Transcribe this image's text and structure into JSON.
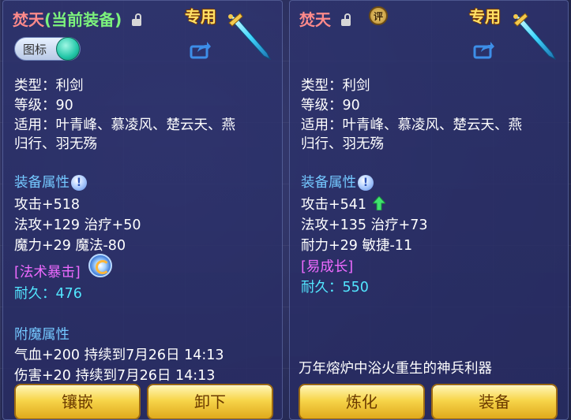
{
  "left": {
    "name": "焚天",
    "equipped_tag": "(当前装备)",
    "exclusive": "专用",
    "toggle_label": "图标",
    "type_line": "类型：利剑",
    "level_line": "等级：90",
    "applicable_line1": "适用：叶青峰、慕凌风、楚云天、燕",
    "applicable_line2": "归行、羽无殇",
    "attributes_title": "装备属性",
    "attack": "攻击+518",
    "magic_heal": "法攻+129 治疗+50",
    "demon_magic": "魔力+29 魔法-80",
    "special": "[法术暴击]",
    "durability_label": "耐久：",
    "durability_value": "476",
    "enchant_title": "附魔属性",
    "enchant1": "气血+200 持续到7月26日 14:13",
    "enchant2": "伤害+20 持续到7月26日 14:13",
    "btn_inlay": "镶嵌",
    "btn_unequip": "卸下"
  },
  "right": {
    "name": "焚天",
    "badge": "评",
    "exclusive": "专用",
    "type_line": "类型：利剑",
    "level_line": "等级：90",
    "applicable_line1": "适用：叶青峰、慕凌风、楚云天、燕",
    "applicable_line2": "归行、羽无殇",
    "attributes_title": "装备属性",
    "attack": "攻击+541",
    "magic_heal": "法攻+135 治疗+73",
    "stamina_agility": "耐力+29 敏捷-11",
    "special": "[易成长]",
    "durability_label": "耐久：",
    "durability_value": "550",
    "description": "万年熔炉中浴火重生的神兵利器",
    "btn_refine": "炼化",
    "btn_equip": "装备"
  },
  "colors": {
    "name": "#ff8a8a",
    "equipped": "#7cf27c",
    "section": "#74c8ff",
    "durability": "#52e6ff",
    "special": "#ee6aff",
    "exclusive": "#ffe066",
    "button": "#f7d54a"
  },
  "icons": [
    "lock-icon",
    "sword-icon",
    "share-icon",
    "info-icon",
    "skill-icon",
    "up-arrow-icon",
    "toggle-knob"
  ]
}
